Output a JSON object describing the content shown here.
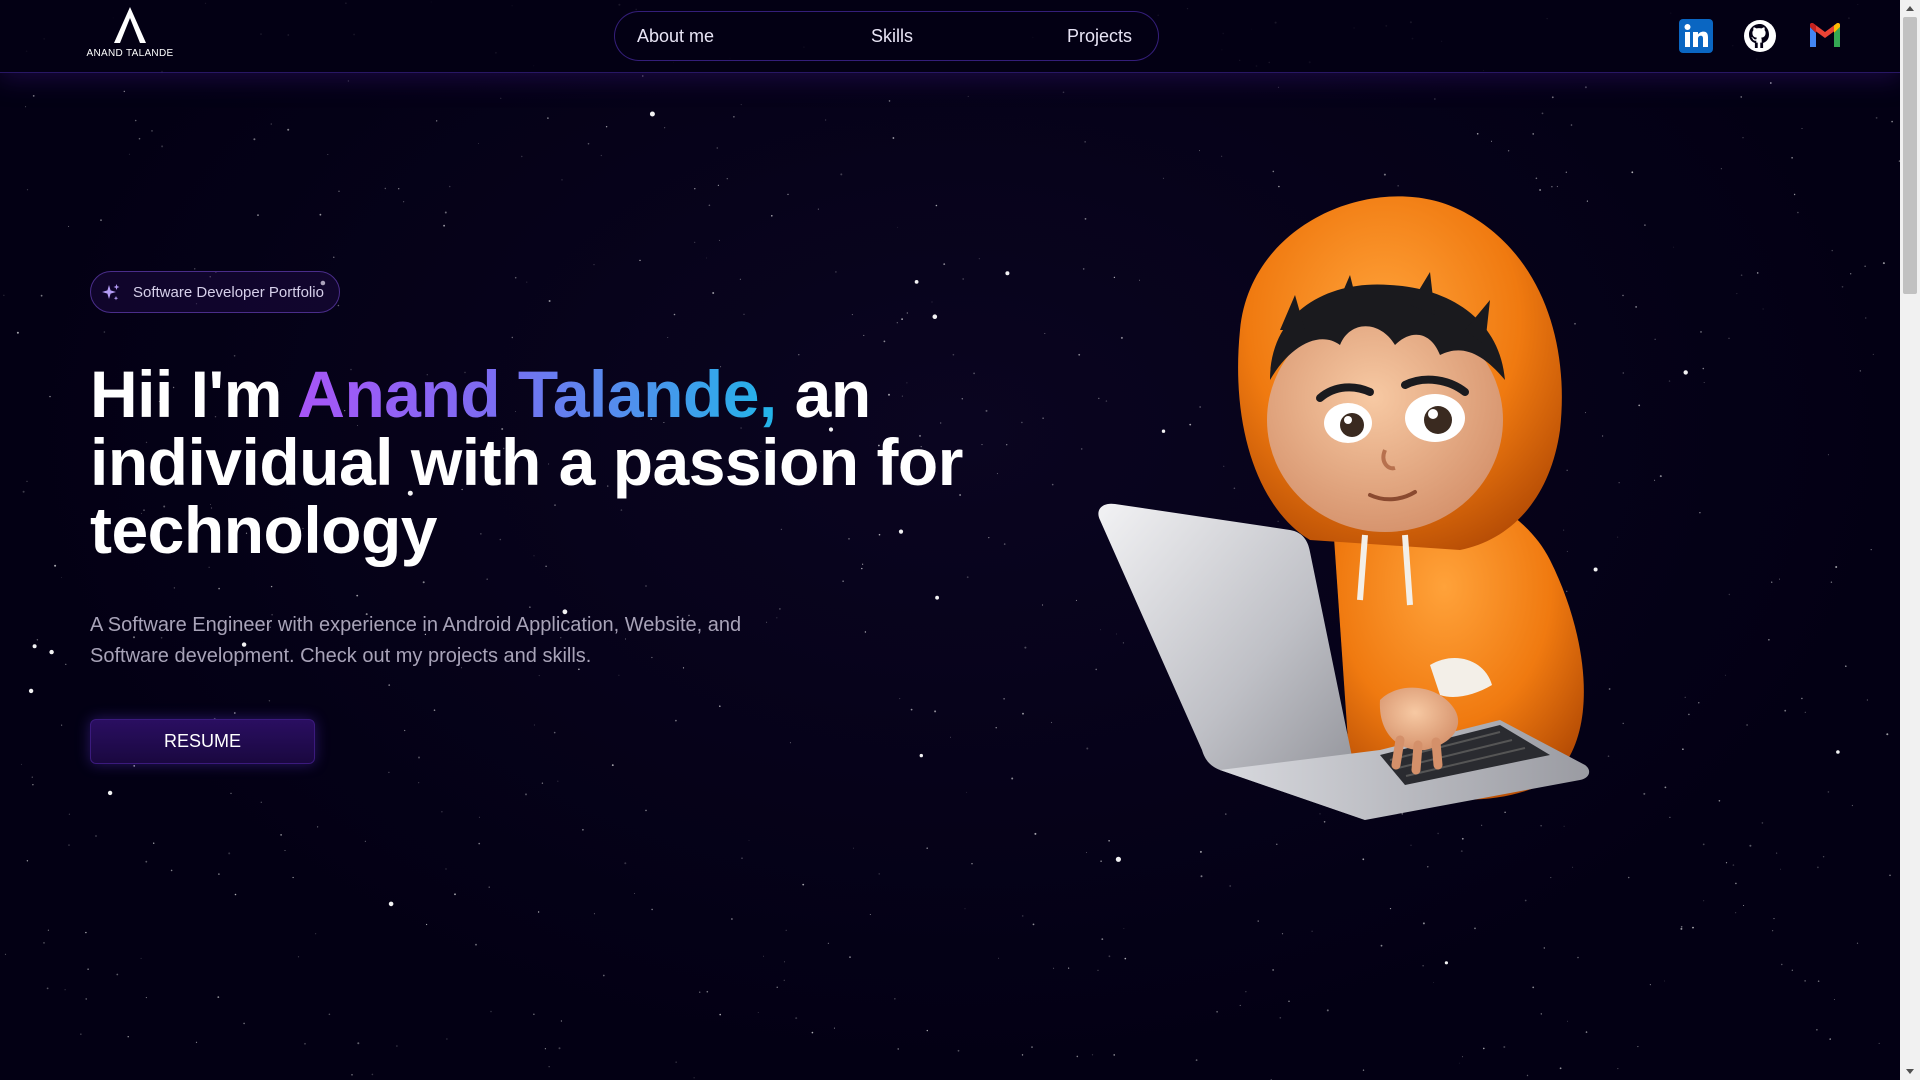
{
  "header": {
    "logo_text": "ANAND TALANDE",
    "nav": [
      {
        "label": "About me"
      },
      {
        "label": "Skills"
      },
      {
        "label": "Projects"
      }
    ],
    "social": [
      {
        "icon": "linkedin-icon",
        "color": "#0a66c2"
      },
      {
        "icon": "github-icon",
        "color": "#ffffff"
      },
      {
        "icon": "gmail-icon",
        "color": "#ea4335"
      }
    ]
  },
  "hero": {
    "badge": {
      "icon": "sparkles-icon",
      "label": "Software Developer Portfolio"
    },
    "headline": {
      "prefix": "Hii I'm ",
      "name": "Anand Talande,",
      "suffix": " an individual with a passion for technology"
    },
    "description": "A Software Engineer with experience in Android Application, Website, and Software development. Check out my projects and skills.",
    "button_label": "RESUME",
    "illustration": "hooded-coder-with-laptop"
  },
  "theme": {
    "background": "#030014",
    "accent": "#7042f8",
    "gradient_start": "#a855f7",
    "gradient_end": "#22b5e8"
  }
}
